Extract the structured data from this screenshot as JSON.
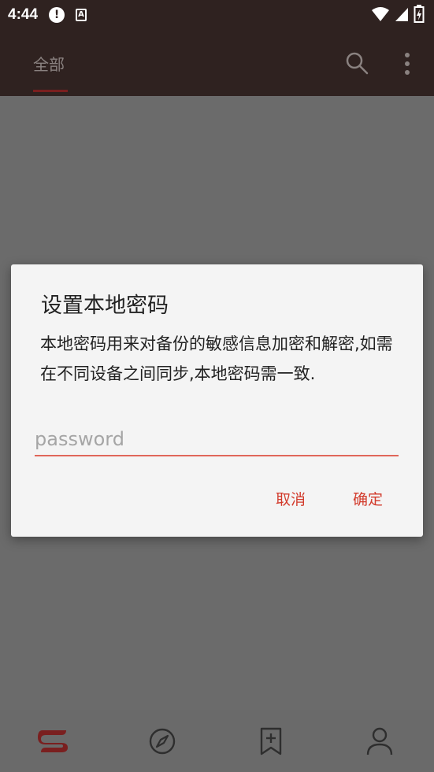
{
  "status_bar": {
    "time": "4:44",
    "alert_glyph": "!",
    "a_glyph": "A"
  },
  "app_bar": {
    "tab_all": "全部"
  },
  "dialog": {
    "title": "设置本地密码",
    "message": "本地密码用来对备份的敏感信息加密和解密,如需在不同设备之间同步,本地密码需一致.",
    "input_placeholder": "password",
    "input_value": "",
    "cancel_label": "取消",
    "ok_label": "确定"
  },
  "bottom_nav": {
    "items": [
      "bookshelf-icon",
      "explore-icon",
      "bookmark-add-icon",
      "profile-icon"
    ]
  },
  "colors": {
    "status_bar_bg": "#2f2220",
    "accent": "#d23b2c",
    "dim_bg": "#6b6b6b"
  }
}
